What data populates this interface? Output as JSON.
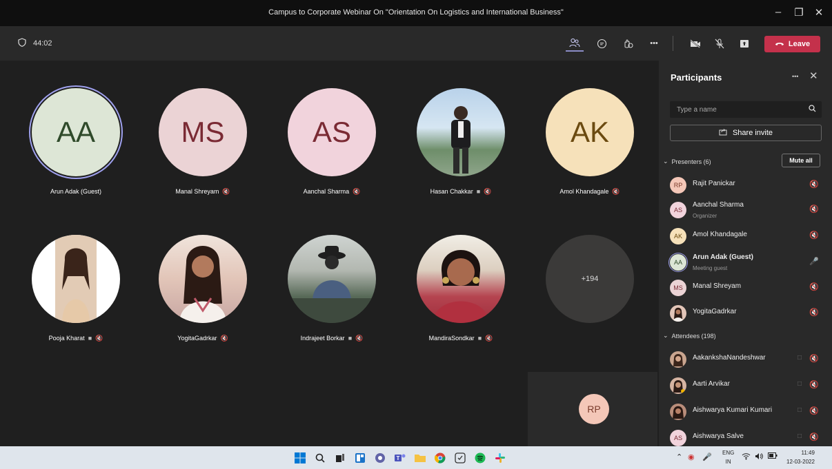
{
  "window": {
    "title": "Campus to Corporate Webinar On \"Orientation On Logistics and International Business\"",
    "minimize": "–",
    "maximize": "❐",
    "close": "✕"
  },
  "toolbar": {
    "timer": "44:02",
    "leave_label": "Leave",
    "more": "•••"
  },
  "stage": {
    "tiles": [
      {
        "initials": "AA",
        "name": "Arun Adak (Guest)",
        "bg": "#dde6d6",
        "fg": "#2f4a2a"
      },
      {
        "initials": "MS",
        "name": "Manal Shreyam",
        "bg": "#ebd3d5",
        "fg": "#7a2a34"
      },
      {
        "initials": "AS",
        "name": "Aanchal Sharma",
        "bg": "#f1d3dc",
        "fg": "#7a2a34"
      },
      {
        "initials": "",
        "name": "Hasan Chakkar",
        "bg": "#b9d2ea",
        "fg": "#000"
      },
      {
        "initials": "AK",
        "name": "Amol Khandagale",
        "bg": "#f6e1ba",
        "fg": "#6b4a10"
      },
      {
        "initials": "",
        "name": "Pooja Kharat",
        "bg": "#e8d9c9",
        "fg": "#000"
      },
      {
        "initials": "",
        "name": "YogitaGadrkar",
        "bg": "#f0e4dc",
        "fg": "#000"
      },
      {
        "initials": "",
        "name": "Indrajeet Borkar",
        "bg": "#cfd4d1",
        "fg": "#000"
      },
      {
        "initials": "",
        "name": "MandiraSondkar",
        "bg": "#f1eee6",
        "fg": "#000"
      },
      {
        "initials": "+194",
        "name": "",
        "bg": "#3b3a39",
        "fg": "#ddd"
      }
    ],
    "self_initials": "RP"
  },
  "panel": {
    "title": "Participants",
    "more": "•••",
    "search_placeholder": "Type a name",
    "share_label": "Share invite",
    "presenters_label": "Presenters (6)",
    "mute_all_label": "Mute all",
    "attendees_label": "Attendees (198)",
    "presenters": [
      {
        "initials": "RP",
        "name": "Rajit Panickar",
        "sub": "",
        "bg": "#f4c7b8",
        "fg": "#7a3a2a"
      },
      {
        "initials": "AS",
        "name": "Aanchal Sharma",
        "sub": "Organizer",
        "bg": "#f1d3dc",
        "fg": "#7a2a34"
      },
      {
        "initials": "AK",
        "name": "Amol Khandagale",
        "sub": "",
        "bg": "#f6e1ba",
        "fg": "#6b4a10"
      },
      {
        "initials": "AA",
        "name": "Arun Adak (Guest)",
        "sub": "Meeting guest",
        "bg": "#dde6d6",
        "fg": "#2f4a2a"
      },
      {
        "initials": "MS",
        "name": "Manal Shreyam",
        "sub": "",
        "bg": "#ebd3d5",
        "fg": "#7a2a34"
      },
      {
        "initials": "",
        "name": "YogitaGadrkar",
        "sub": "",
        "bg": "#e2c5b8",
        "fg": "#000"
      }
    ],
    "attendees": [
      {
        "initials": "",
        "name": "AakankshaNandeshwar",
        "bg": "#c9a58f",
        "fg": "#000"
      },
      {
        "initials": "",
        "name": "Aarti Arvikar",
        "bg": "#d6b4a2",
        "fg": "#000"
      },
      {
        "initials": "",
        "name": "Aishwarya Kumari Kumari",
        "bg": "#b98d7a",
        "fg": "#000"
      },
      {
        "initials": "AS",
        "name": "Aishwarya Salve",
        "bg": "#f1d3dc",
        "fg": "#7a2a34"
      }
    ]
  },
  "taskbar": {
    "lang_top": "ENG",
    "lang_bottom": "IN",
    "time": "11:49",
    "date": "12-03-2022"
  }
}
